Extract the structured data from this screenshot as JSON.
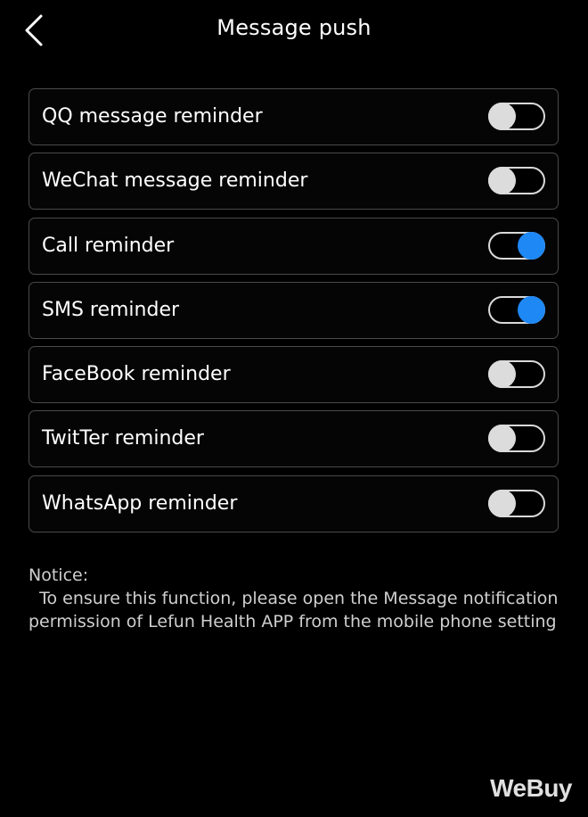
{
  "header": {
    "title": "Message push",
    "back_icon": "chevron-left-icon"
  },
  "colors": {
    "background": "#000000",
    "row_border": "#4a4a4a",
    "toggle_on": "#1e88f5",
    "toggle_off_knob": "#dcdcdc"
  },
  "reminders": [
    {
      "label": "QQ message reminder",
      "enabled": false
    },
    {
      "label": "WeChat message reminder",
      "enabled": false
    },
    {
      "label": "Call reminder",
      "enabled": true
    },
    {
      "label": "SMS reminder",
      "enabled": true
    },
    {
      "label": "FaceBook reminder",
      "enabled": false
    },
    {
      "label": "TwitTer reminder",
      "enabled": false
    },
    {
      "label": "WhatsApp reminder",
      "enabled": false
    }
  ],
  "notice": {
    "title": "Notice:",
    "body": "  To ensure this function, please open the Message notification permission of Lefun Health APP from the mobile phone setting"
  },
  "watermark": "WeBuy"
}
